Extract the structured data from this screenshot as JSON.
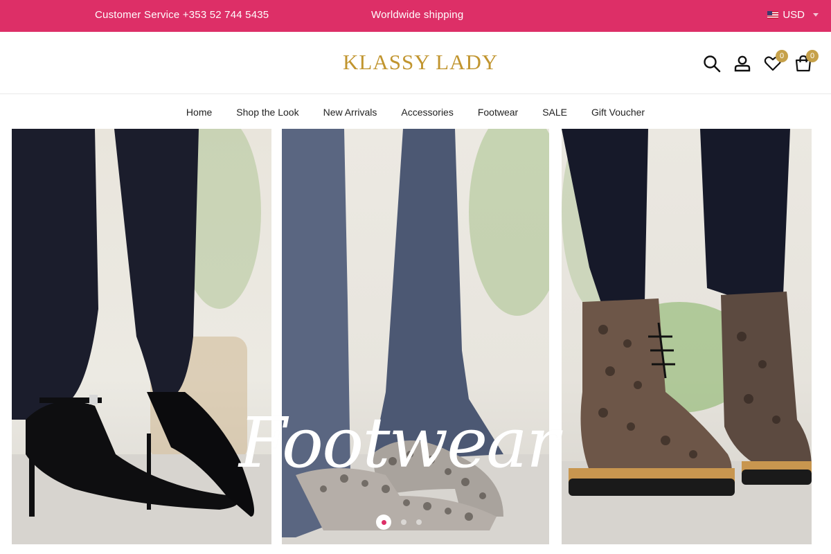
{
  "topbar": {
    "customer_service": "Customer Service +353 52 744 5435",
    "shipping": "Worldwide shipping",
    "currency": "USD",
    "background_color": "#dd2f67"
  },
  "header": {
    "logo": "KLASSY LADY",
    "logo_color": "#c1952f",
    "icons": [
      "search-icon",
      "account-icon",
      "heart-icon",
      "cart-icon"
    ],
    "wishlist_count": "0",
    "cart_count": "0"
  },
  "nav": {
    "items": [
      {
        "label": "Home"
      },
      {
        "label": "Shop the Look"
      },
      {
        "label": "New Arrivals"
      },
      {
        "label": "Accessories"
      },
      {
        "label": "Footwear"
      },
      {
        "label": "SALE"
      },
      {
        "label": "Gift Voucher"
      }
    ]
  },
  "hero": {
    "title": "Footwear",
    "slides": 3,
    "active_slide": 1
  }
}
